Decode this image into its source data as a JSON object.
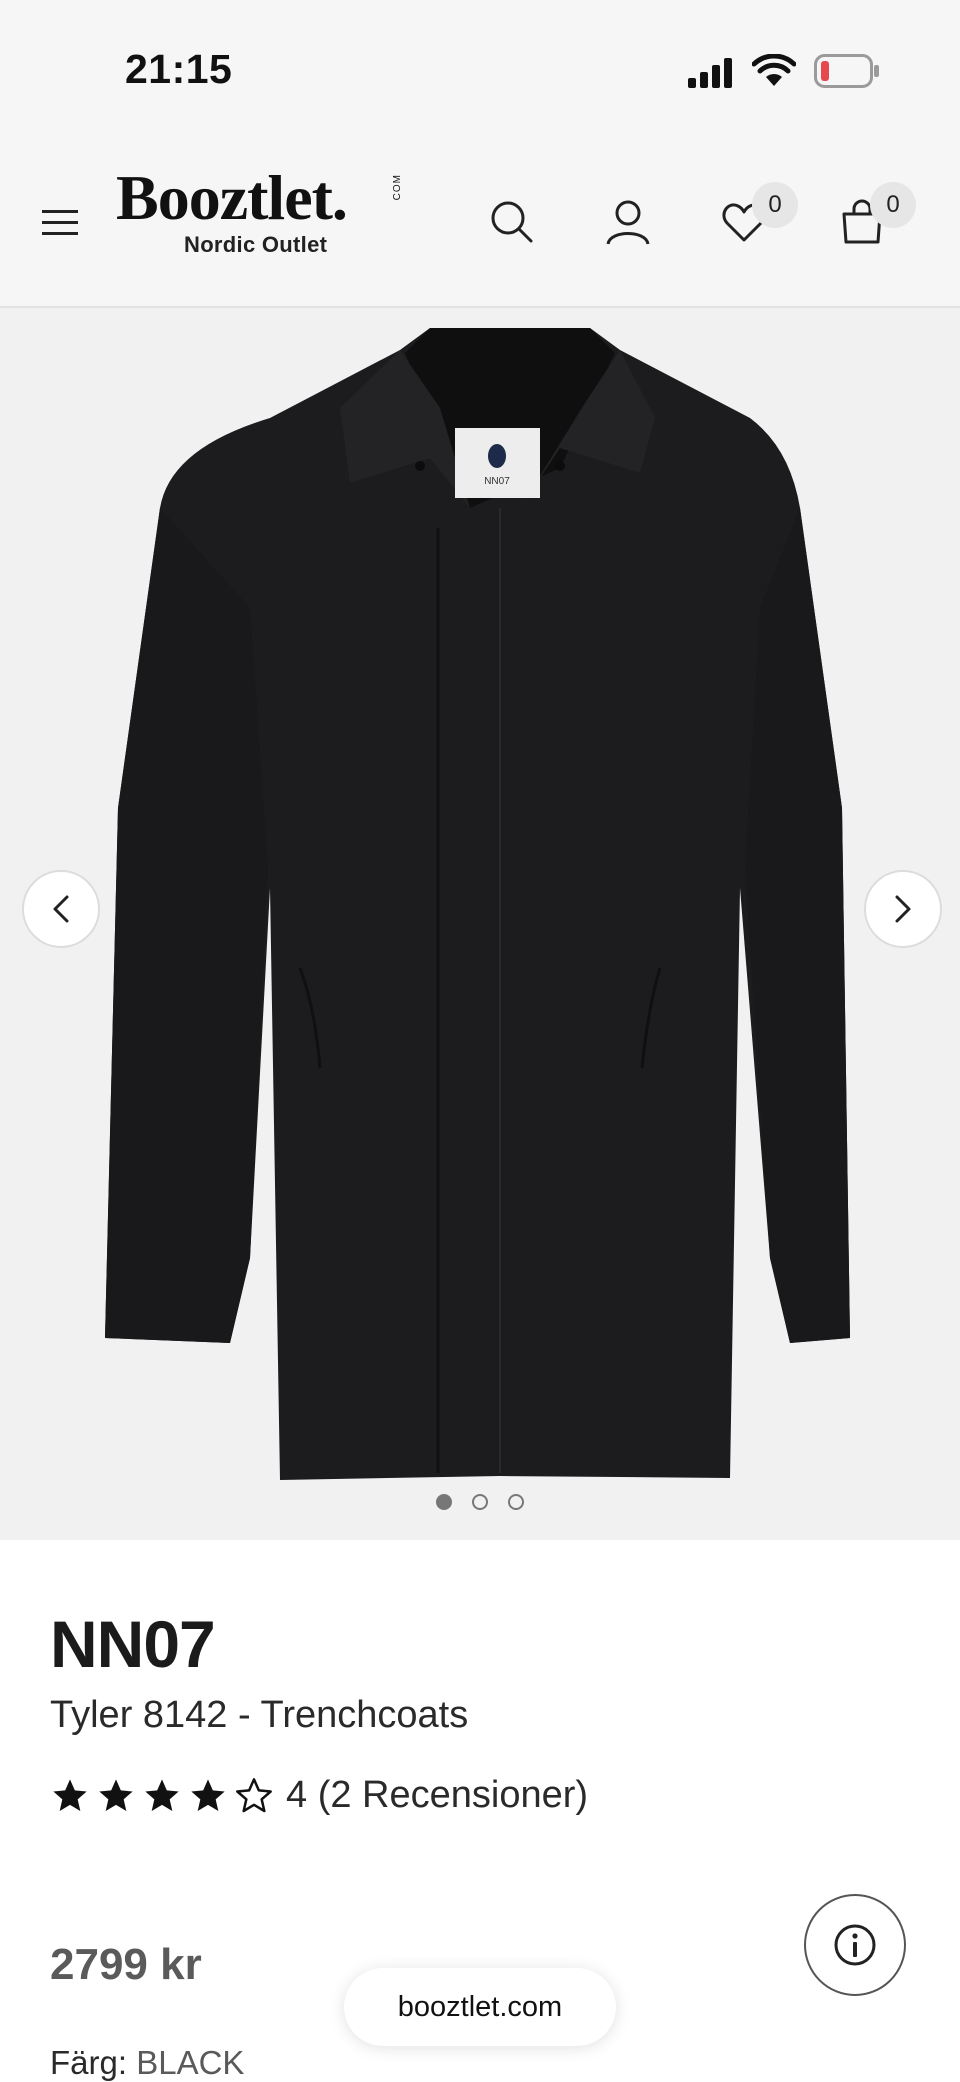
{
  "status_bar": {
    "time": "21:15"
  },
  "header": {
    "logo": {
      "word": "Booztlet",
      "dot": ".",
      "com": "COM",
      "subtitle": "Nordic Outlet"
    },
    "wishlist_count": "0",
    "cart_count": "0"
  },
  "gallery": {
    "slide_count": 3,
    "active_slide": 1,
    "garment_label": "NN07"
  },
  "product": {
    "brand": "NN07",
    "name": "Tyler 8142 - Trenchcoats",
    "rating_value": 4,
    "rating_max": 5,
    "rating_text": "4 (2 Recensioner)",
    "price": "2799 kr",
    "color_label": "Färg:",
    "color_value": "BLACK"
  },
  "browser": {
    "url": "booztlet.com"
  },
  "colors": {
    "header_bg": "#f6f6f6",
    "gallery_bg": "#f1f1f1",
    "text": "#1a1a1a",
    "price": "#5a5a5a",
    "battery_low": "#e5484d"
  }
}
